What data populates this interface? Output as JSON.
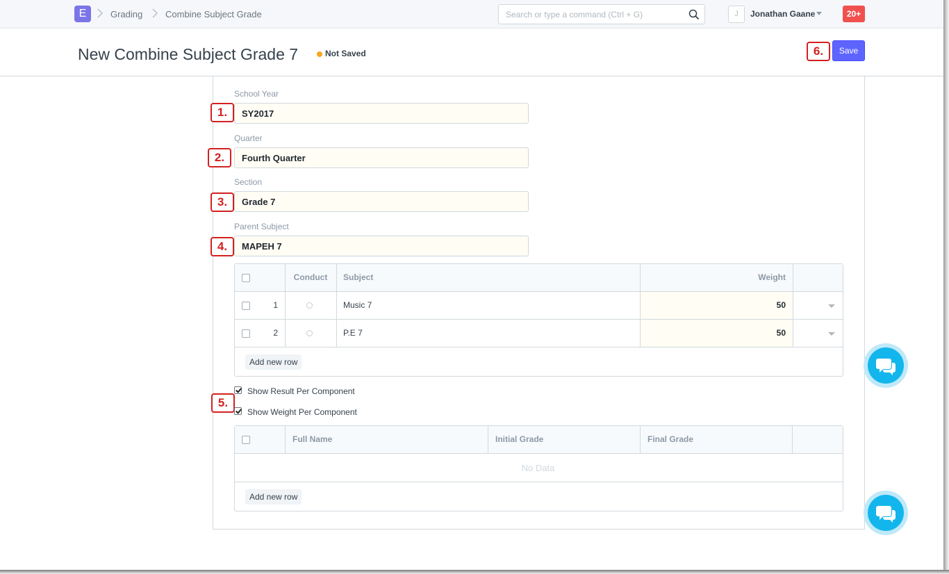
{
  "navbar": {
    "logo_letter": "E",
    "breadcrumbs": [
      "Grading",
      "Combine Subject Grade"
    ],
    "search_placeholder": "Search or type a command (Ctrl + G)",
    "avatar_initial": "J",
    "user_name": "Jonathan Gaane",
    "notifications": "20+"
  },
  "page": {
    "title": "New Combine Subject Grade 7",
    "status": "Not Saved",
    "save_label": "Save"
  },
  "markers": [
    "1.",
    "2.",
    "3.",
    "4.",
    "5.",
    "6."
  ],
  "form": {
    "school_year": {
      "label": "School Year",
      "value": "SY2017"
    },
    "quarter": {
      "label": "Quarter",
      "value": "Fourth Quarter"
    },
    "section": {
      "label": "Section",
      "value": "Grade 7"
    },
    "parent_subject": {
      "label": "Parent Subject",
      "value": "MAPEH 7"
    }
  },
  "subjects_table": {
    "columns": [
      "Conduct",
      "Subject",
      "Weight"
    ],
    "rows": [
      {
        "idx": "1",
        "subject": "Music 7",
        "weight": "50"
      },
      {
        "idx": "2",
        "subject": "P.E 7",
        "weight": "50"
      }
    ],
    "add_row_label": "Add new row"
  },
  "options": {
    "show_result": {
      "label": "Show Result Per Component",
      "checked": true
    },
    "show_weight": {
      "label": "Show Weight Per Component",
      "checked": true
    }
  },
  "results_table": {
    "columns": [
      "Full Name",
      "Initial Grade",
      "Final Grade"
    ],
    "empty_text": "No Data",
    "add_row_label": "Add new row"
  },
  "colors": {
    "primary": "#5e64ff",
    "marker": "#d32020",
    "badge": "#f0514f",
    "chat": "#13b6ec",
    "status_dot": "#f8a71c"
  }
}
